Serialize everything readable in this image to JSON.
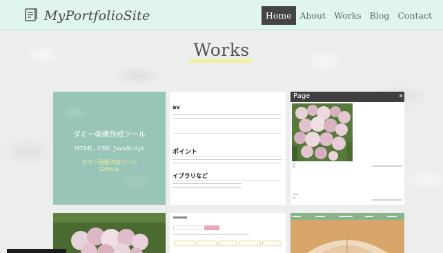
{
  "site": {
    "title": "MyPortfolioSite",
    "logo_icon": "document-icon"
  },
  "nav": {
    "items": [
      {
        "label": "Home",
        "active": true
      },
      {
        "label": "About",
        "active": false
      },
      {
        "label": "Works",
        "active": false
      },
      {
        "label": "Blog",
        "active": false
      },
      {
        "label": "Contact",
        "active": false
      }
    ]
  },
  "page": {
    "title": "Works",
    "accent_color": "#f3ef9c"
  },
  "works": {
    "card1": {
      "title": "ダミー画像作成ツール",
      "tech": "HTML, CSS, JavaScript",
      "link_line1": "ダミー画像作成ツール",
      "link_line2": "GitHub"
    },
    "card2": {
      "breadcrumb": "",
      "heading1": "av",
      "heading2": "ポイント",
      "heading3": "イブラリなど"
    },
    "card3": {
      "bar_title": "Page"
    }
  }
}
